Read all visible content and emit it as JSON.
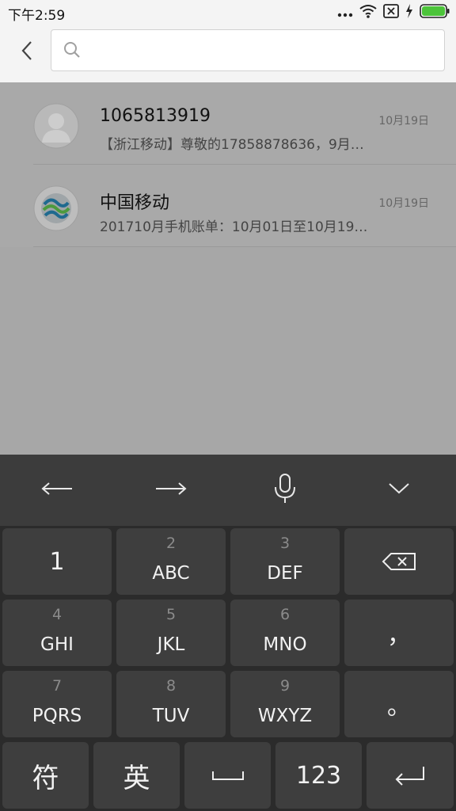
{
  "status_bar": {
    "time": "下午2:59"
  },
  "search": {
    "value": "",
    "placeholder": ""
  },
  "conversations": [
    {
      "name": "1065813919",
      "snippet": "【浙江移动】尊敬的17858878636，9月…",
      "date": "10月19日",
      "avatar_icon": "default-person-avatar"
    },
    {
      "name": "中国移动",
      "snippet": "201710月手机账单：10月01日至10月19…",
      "date": "10月19日",
      "avatar_icon": "china-mobile-logo"
    }
  ],
  "keyboard": {
    "toolbar": [
      "left-arrow-icon",
      "right-arrow-icon",
      "microphone-icon",
      "collapse-keyboard-icon"
    ],
    "keys": {
      "k1": {
        "main": "1"
      },
      "k2": {
        "sub": "2",
        "main": "ABC"
      },
      "k3": {
        "sub": "3",
        "main": "DEF"
      },
      "k4": {
        "sub": "4",
        "main": "GHI"
      },
      "k5": {
        "sub": "5",
        "main": "JKL"
      },
      "k6": {
        "sub": "6",
        "main": "MNO"
      },
      "comma": {
        "main": "，"
      },
      "k7": {
        "sub": "7",
        "main": "PQRS"
      },
      "k8": {
        "sub": "8",
        "main": "TUV"
      },
      "k9": {
        "sub": "9",
        "main": "WXYZ"
      },
      "period": {
        "main": "。"
      },
      "symbols": {
        "main": "符"
      },
      "english": {
        "main": "英"
      },
      "num": {
        "main": "123"
      }
    }
  },
  "colors": {
    "accent_battery": "#4cc43a",
    "keyboard_bg": "#2b2b2b",
    "key_bg": "#3e3e3e",
    "dim_overlay": "#a7a7a7"
  }
}
